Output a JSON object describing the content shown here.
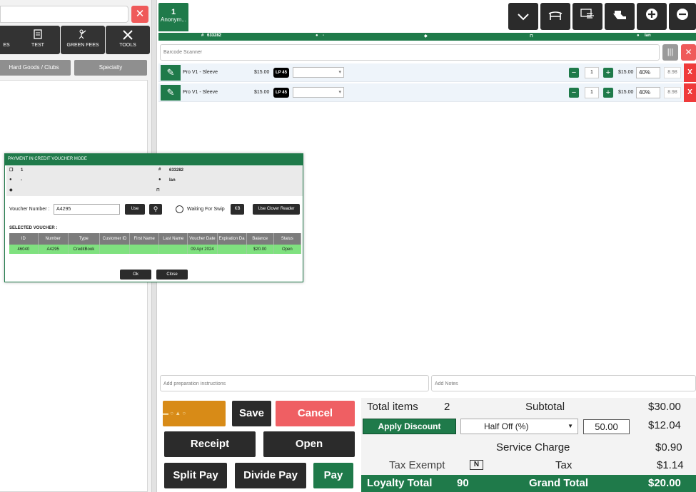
{
  "left_pane": {
    "search_close": "✕",
    "tiles": [
      {
        "label": "ES",
        "icon": "partial-tile-icon"
      },
      {
        "label": "TEST",
        "icon": "document-icon"
      },
      {
        "label": "GREEN FEES",
        "icon": "golfer-icon"
      },
      {
        "label": "TOOLS",
        "icon": "tools-icon"
      }
    ],
    "categories": [
      "Hard Goods / Clubs",
      "Specialty"
    ]
  },
  "cart": {
    "tab": {
      "number": "1",
      "label": "Anonym..."
    },
    "top_icons": [
      "chevron-down-icon",
      "table-icon",
      "hand-pointer-icon",
      "hand-card-icon",
      "plus-circle-icon",
      "minus-circle-icon"
    ],
    "info_bar": {
      "id": "633282",
      "customer": "-",
      "server": "Ian"
    },
    "barcode_placeholder": "Barcode Scanner",
    "items": [
      {
        "name": "Pro V1 - Sleeve",
        "price": "$15.00",
        "badge": "LP 45",
        "qty": "1",
        "ext": "$15.00",
        "discount": "40%",
        "net": "8.98"
      },
      {
        "name": "Pro V1 - Sleeve",
        "price": "$15.00",
        "badge": "LP 45",
        "qty": "1",
        "ext": "$15.00",
        "discount": "40%",
        "net": "8.98"
      }
    ],
    "prep_placeholder": "Add preparation instructions",
    "notes_placeholder": "Add Notes"
  },
  "buttons": {
    "save": "Save",
    "cancel": "Cancel",
    "receipt": "Receipt",
    "open": "Open",
    "split_pay": "Split Pay",
    "divide_pay": "Divide Pay",
    "pay": "Pay"
  },
  "totals": {
    "total_items_label": "Total items",
    "total_items": "2",
    "subtotal_label": "Subtotal",
    "subtotal": "$30.00",
    "apply_discount": "Apply Discount",
    "discount_type": "Half Off  (%)",
    "discount_value": "50.00",
    "discount_amount": "$12.04",
    "service_charge_label": "Service Charge",
    "service_charge": "$0.90",
    "tax_exempt_label": "Tax Exempt",
    "tax_exempt_flag": "N",
    "tax_label": "Tax",
    "tax": "$1.14",
    "loyalty_total_label": "Loyalty Total",
    "loyalty_total": "90",
    "grand_total_label": "Grand Total",
    "grand_total": "$20.00"
  },
  "modal": {
    "title": "PAYMENT IN CREDIT VOUCHER MODE",
    "info": {
      "count": "1",
      "id": "633282",
      "customer": "-",
      "server": "Ian"
    },
    "voucher_label": "Voucher Number :",
    "voucher_value": "A4295",
    "use_btn": "Use",
    "waiting_label": "Waiting For Swip",
    "kb_btn": "KB",
    "clover_btn": "Use Clover Reader",
    "selected_label": "SELECTED VOUCHER :",
    "columns": [
      "ID",
      "Number",
      "Type",
      "Customer ID",
      "First Name",
      "Last Name",
      "Voucher Date",
      "Expiration Da",
      "Balance",
      "Status"
    ],
    "row": [
      "46040",
      "A4295",
      "CreditBook",
      "",
      "",
      "",
      "09 Apr 2024",
      "",
      "$20.00",
      "Open"
    ],
    "ok_btn": "Ok",
    "close_btn": "Close"
  }
}
